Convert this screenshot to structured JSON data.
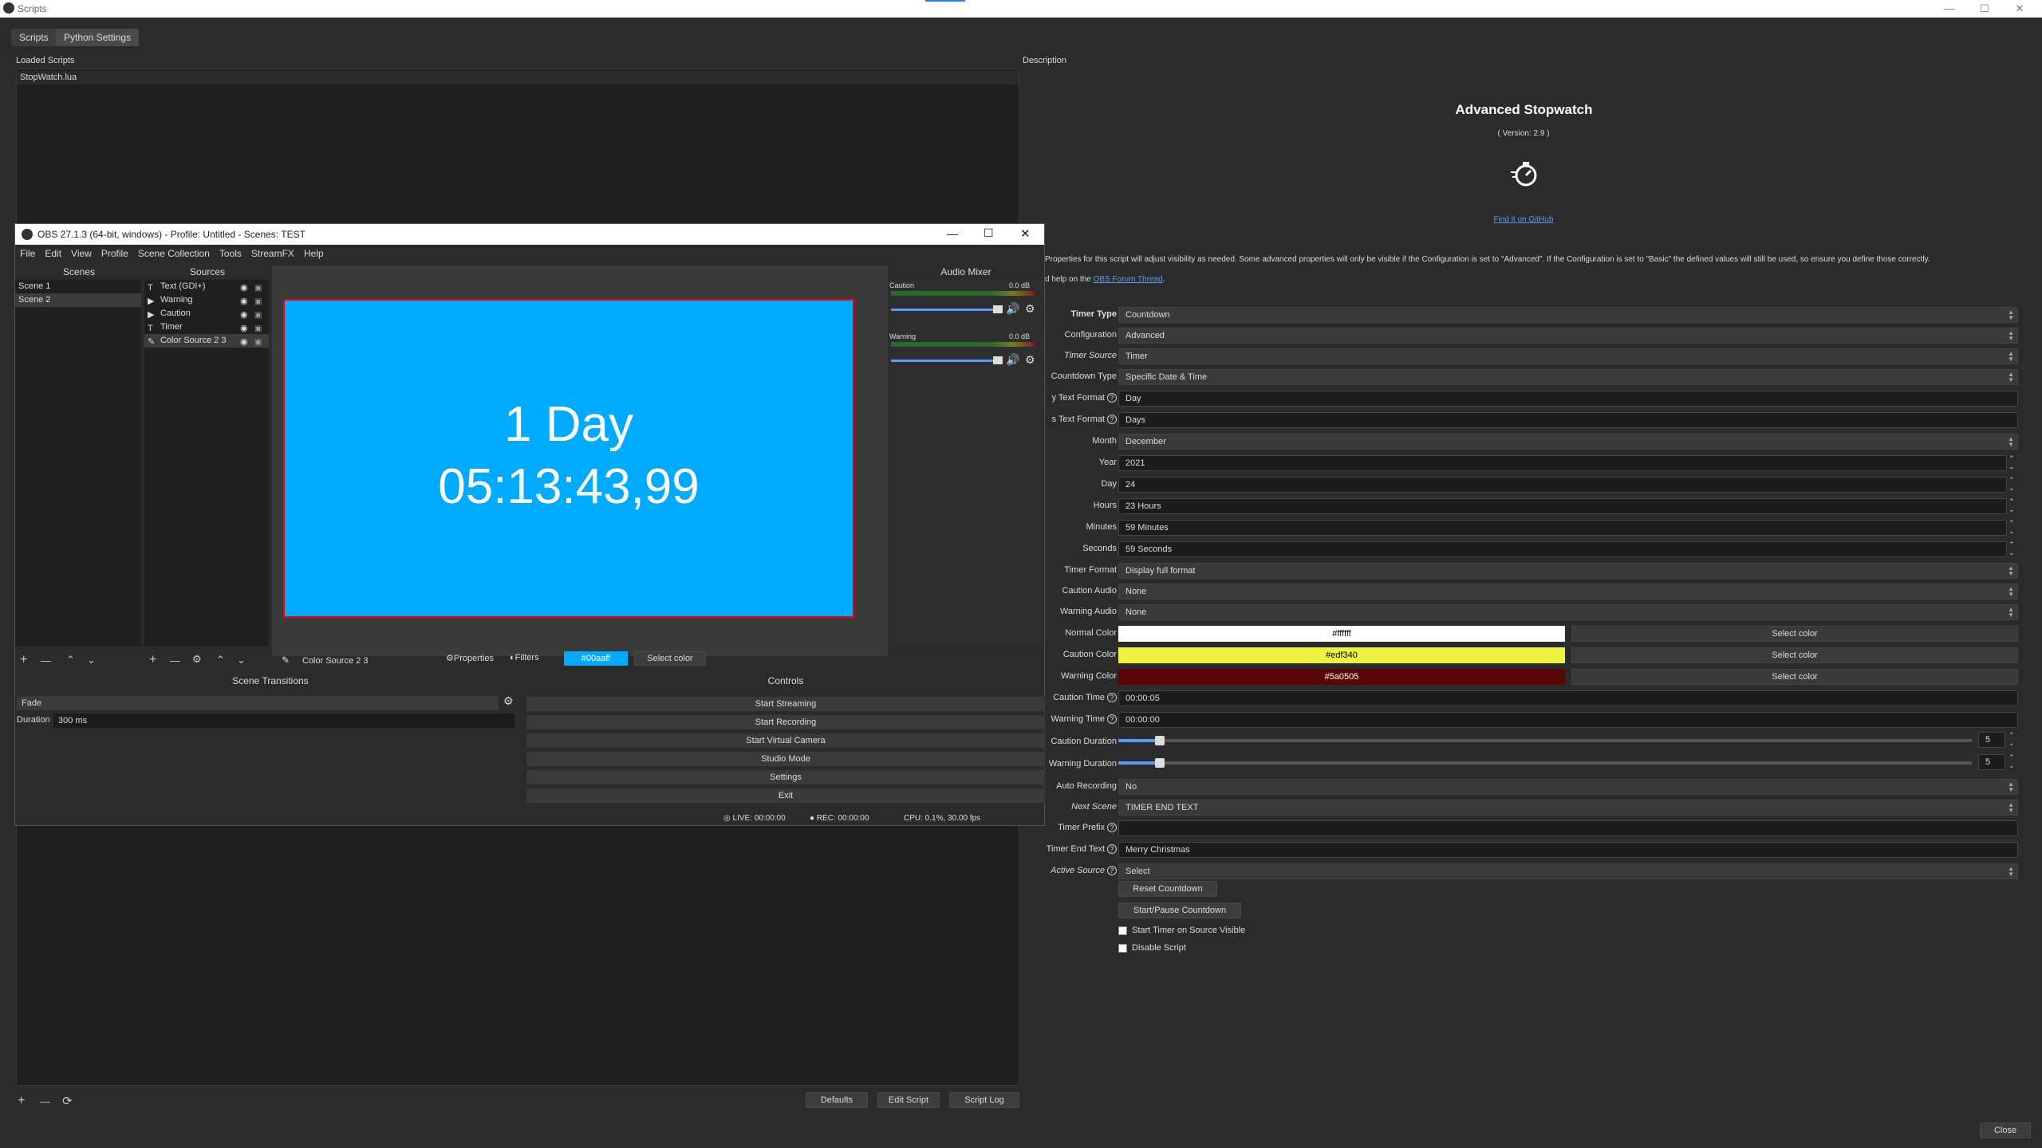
{
  "window": {
    "title": "Scripts",
    "min_icon": "minimize-icon",
    "max_icon": "maximize-icon",
    "close_icon": "close-icon",
    "min_glyph": "—",
    "max_glyph": "☐",
    "close_glyph": "✕"
  },
  "tabs": [
    "Scripts",
    "Python Settings"
  ],
  "loaded_scripts": {
    "label": "Loaded Scripts",
    "items": [
      "StopWatch.lua"
    ]
  },
  "bottom_buttons": {
    "add": "+",
    "remove": "—",
    "reload": "⟳",
    "defaults": "Defaults",
    "edit_script": "Edit Script",
    "script_log": "Script Log"
  },
  "description": {
    "label": "Description",
    "title": "Advanced Stopwatch",
    "version": "( Version: 2.9 )",
    "github_link": "Find it on GitHub",
    "text1": "Properties for this script will adjust visibility as needed. Some advanced properties will only be visible if the Configuration is set to \"Advanced\". If the Configuration is set to \"Basic\" the defined values will still be used, so ensure you define those correctly.",
    "text2_prefix": "d help on the ",
    "text2_link": "OBS Forum Thread",
    "text2_suffix": "."
  },
  "properties": {
    "timer_type": {
      "label": "Timer Type",
      "value": "Countdown"
    },
    "configuration": {
      "label": "Configuration",
      "value": "Advanced"
    },
    "timer_source": {
      "label": "Timer Source",
      "value": "Timer"
    },
    "countdown_type": {
      "label": "Countdown Type",
      "value": "Specific Date & Time"
    },
    "day_text_format": {
      "label": "y Text Format",
      "value": "Day"
    },
    "days_text_format": {
      "label": "s Text Format",
      "value": "Days"
    },
    "month": {
      "label": "Month",
      "value": "December"
    },
    "year": {
      "label": "Year",
      "value": "2021"
    },
    "day": {
      "label": "Day",
      "value": "24"
    },
    "hours": {
      "label": "Hours",
      "value": "23 Hours"
    },
    "minutes": {
      "label": "Minutes",
      "value": "59 Minutes"
    },
    "seconds": {
      "label": "Seconds",
      "value": "59 Seconds"
    },
    "timer_format": {
      "label": "Timer Format",
      "value": "Display full format"
    },
    "caution_audio": {
      "label": "Caution Audio",
      "value": "None"
    },
    "warning_audio": {
      "label": "Warning Audio",
      "value": "None"
    },
    "normal_color": {
      "label": "Normal Color",
      "value": "#ffffff",
      "bg": "#ffffff",
      "fg": "#000000"
    },
    "caution_color": {
      "label": "Caution Color",
      "value": "#edf340",
      "bg": "#edf340",
      "fg": "#000000"
    },
    "warning_color": {
      "label": "Warning Color",
      "value": "#5a0505",
      "bg": "#5a0505",
      "fg": "#ffffff"
    },
    "select_color": "Select color",
    "caution_time": {
      "label": "Caution Time",
      "value": "00:00:05"
    },
    "warning_time": {
      "label": "Warning Time",
      "value": "00:00:00"
    },
    "caution_duration": {
      "label": "Caution Duration",
      "value": "5"
    },
    "warning_duration": {
      "label": "Warning Duration",
      "value": "5"
    },
    "auto_recording": {
      "label": "Auto Recording",
      "value": "No"
    },
    "next_scene": {
      "label": "Next Scene",
      "value": "TIMER END TEXT"
    },
    "timer_prefix": {
      "label": "Timer Prefix",
      "value": ""
    },
    "timer_end_text": {
      "label": "Timer End Text",
      "value": "Merry Christmas"
    },
    "active_source": {
      "label": "Active Source",
      "value": "Select"
    },
    "reset_countdown": "Reset Countdown",
    "start_pause": "Start/Pause Countdown",
    "start_on_visible": "Start Timer on Source Visible",
    "disable_script": "Disable Script"
  },
  "close_button": "Close",
  "obs": {
    "title": "OBS 27.1.3 (64-bit, windows) - Profile: Untitled - Scenes: TEST",
    "menu": [
      "File",
      "Edit",
      "View",
      "Profile",
      "Scene Collection",
      "Tools",
      "StreamFX",
      "Help"
    ],
    "scenes_header": "Scenes",
    "scenes": [
      "Scene 1",
      "Scene 2"
    ],
    "sources_header": "Sources",
    "sources": [
      "Text (GDI+)",
      "Warning",
      "Caution",
      "Timer",
      "Color Source 2 3"
    ],
    "preview_line1": "1 Day",
    "preview_line2": "05:13:43,99",
    "preview_color": "#00aaff",
    "audio_header": "Audio Mixer",
    "audio_channels": [
      {
        "name": "Caution",
        "db": "0.0 dB"
      },
      {
        "name": "Warning",
        "db": "0.0 dB"
      }
    ],
    "selected_source": "Color Source 2 3",
    "properties_btn": "Properties",
    "filters_btn": "Filters",
    "color_value": "#00aaff",
    "select_color": "Select color",
    "transitions_header": "Scene Transitions",
    "transition": "Fade",
    "duration_label": "Duration",
    "duration_value": "300 ms",
    "controls_header": "Controls",
    "controls": [
      "Start Streaming",
      "Start Recording",
      "Start Virtual Camera",
      "Studio Mode",
      "Settings",
      "Exit"
    ],
    "status_live": "LIVE: 00:00:00",
    "status_rec": "REC: 00:00:00",
    "status_cpu": "CPU: 0.1%, 30.00 fps"
  }
}
